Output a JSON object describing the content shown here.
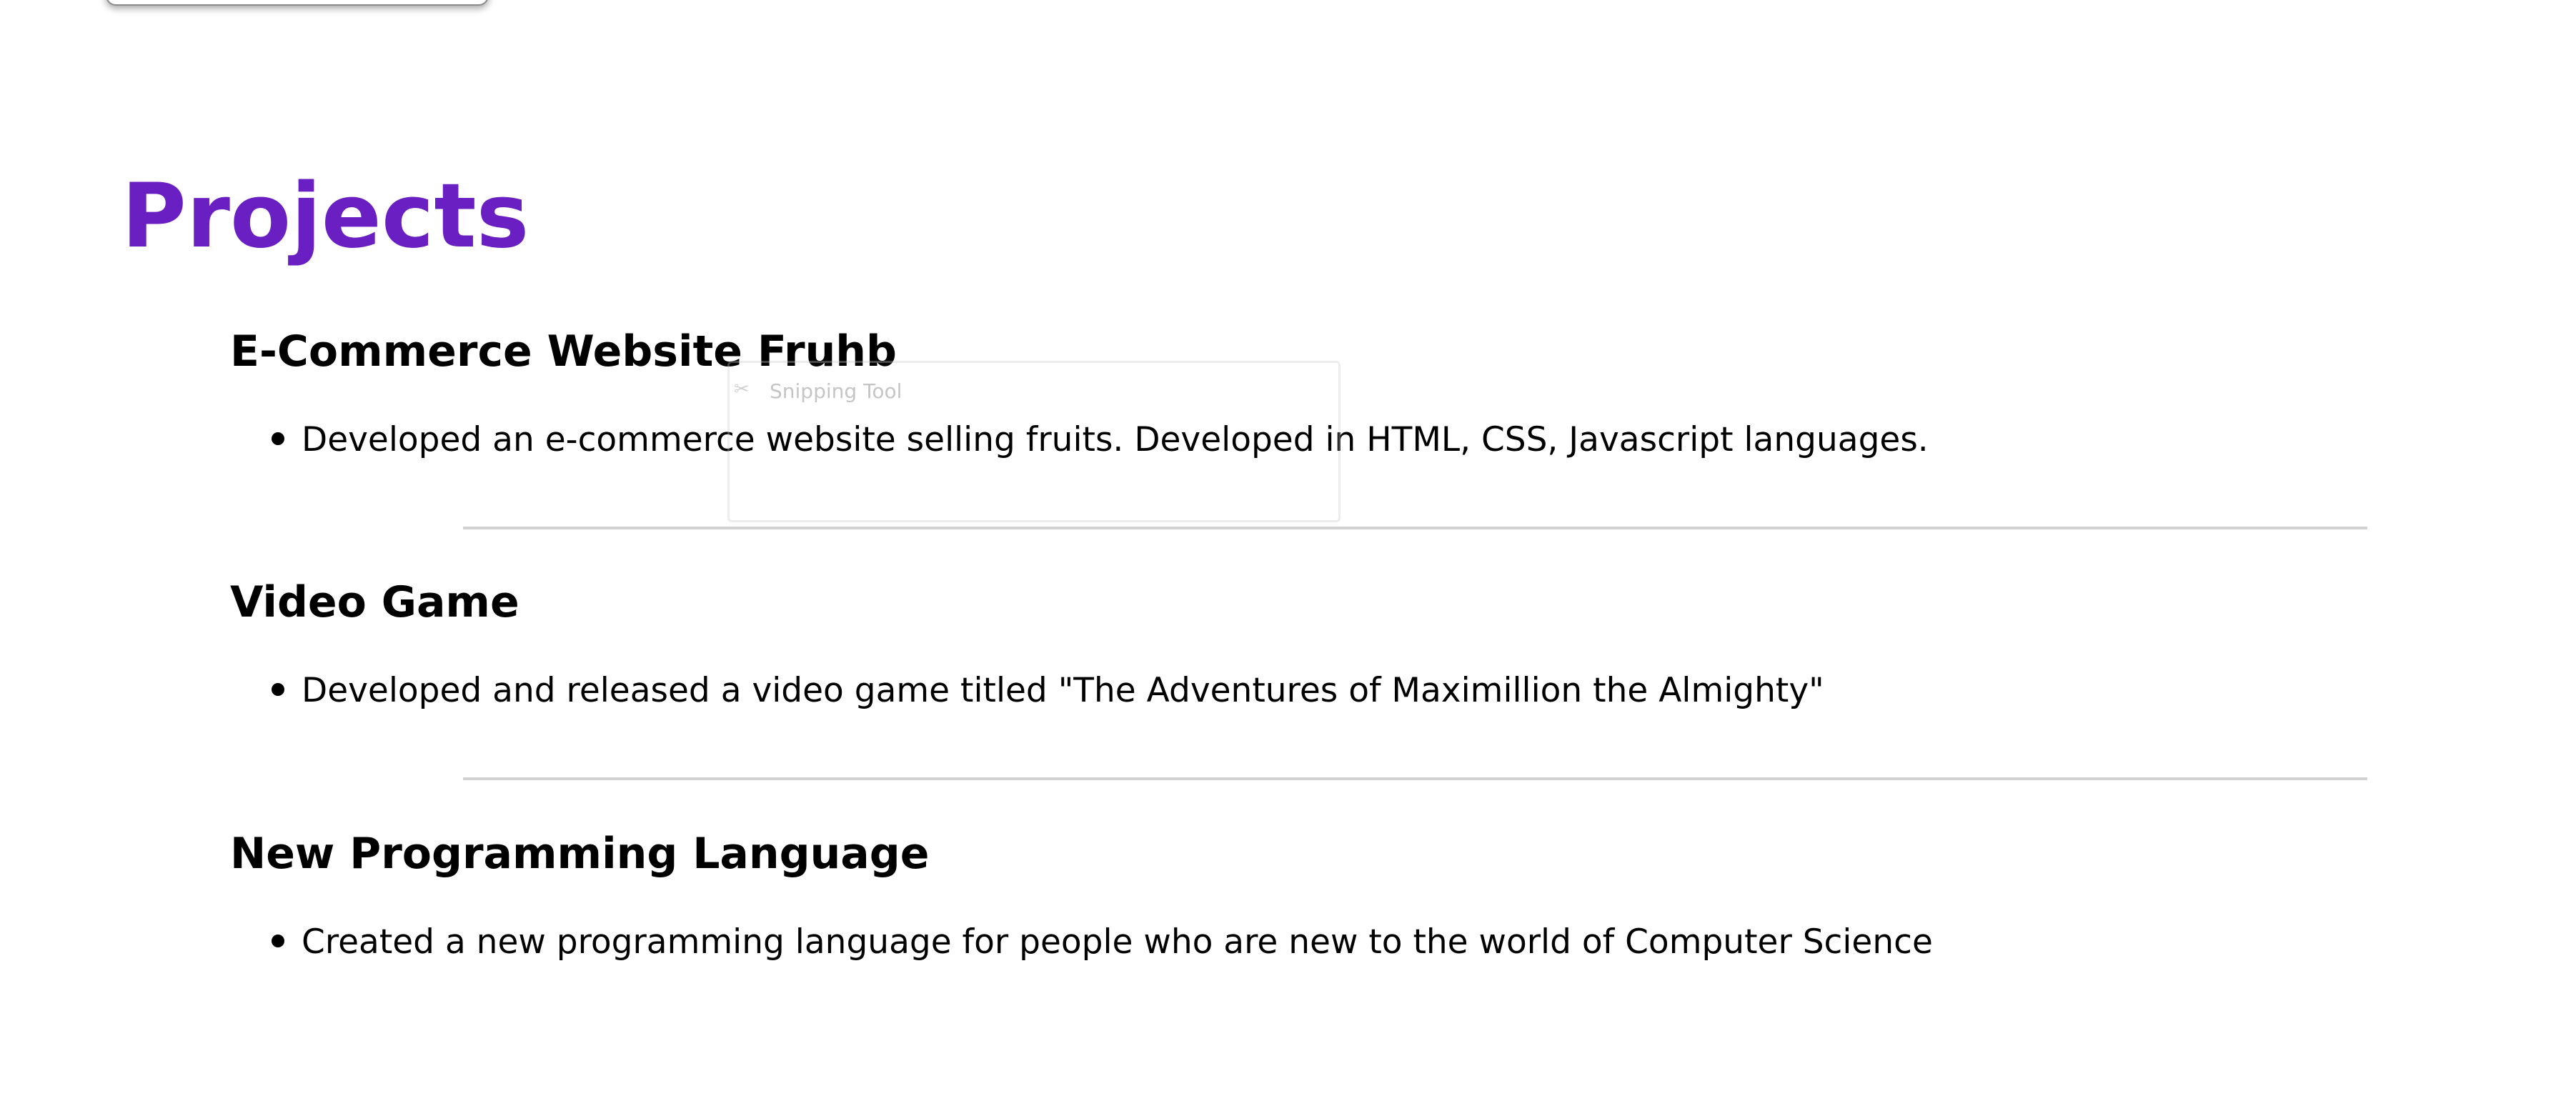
{
  "page": {
    "title": "Projects"
  },
  "projects": [
    {
      "title": "E-Commerce Website Fruhb",
      "bullet": "Developed an e-commerce website selling fruits. Developed in HTML, CSS, Javascript languages."
    },
    {
      "title": "Video Game",
      "bullet": "Developed and released a video game titled \"The Adventures of Maximillion the Almighty\""
    },
    {
      "title": "New Programming Language",
      "bullet": "Created a new programming language for people who are new to the world of Computer Science"
    }
  ],
  "overlay": {
    "snipping_tool_label": "Snipping Tool",
    "snipping_tool_icon": "scissors-icon"
  },
  "colors": {
    "title": "#6a1fc2",
    "divider": "#d2d2d2"
  }
}
